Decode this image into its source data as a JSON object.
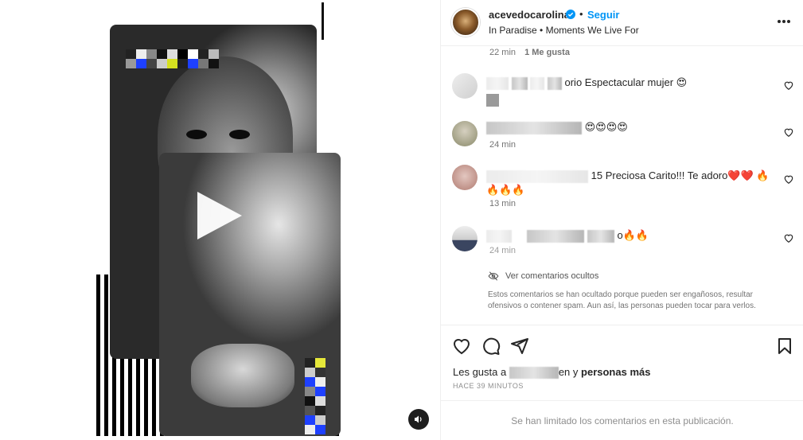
{
  "post": {
    "username": "acevedocarolina",
    "follow_label": "Seguir",
    "dot": "•",
    "location": "In Paradise • Moments We Live For"
  },
  "top_meta": {
    "time": "22 min",
    "likes": "1 Me gusta"
  },
  "comments": [
    {
      "text_visible": "orio Espectacular mujer 😍",
      "time": ""
    },
    {
      "text_visible": "😍😍😍😍",
      "time": "24 min"
    },
    {
      "text_visible": "15 Preciosa Carito!!! Te adoro❤️❤️ 🔥",
      "line2": "🔥🔥🔥",
      "time": "13 min"
    },
    {
      "text_visible": "o🔥🔥",
      "time": "24 min"
    }
  ],
  "hidden_comments": {
    "toggle_label": "Ver comentarios ocultos",
    "note": "Estos comentarios se han ocultado porque pueden ser engañosos, resultar ofensivos o contener spam. Aun así, las personas pueden tocar para verlos."
  },
  "likes_line": {
    "prefix": "Les gusta a ",
    "middle": "en",
    "suffix": " y ",
    "bold": "personas más"
  },
  "post_time": "HACE 39 MINUTOS",
  "limited_comments": "Se han limitado los comentarios en esta publicación.",
  "colors": {
    "accent": "#0095f6",
    "verified": "#0095f6",
    "text": "#262626",
    "muted": "#737373"
  },
  "icons": [
    "verified-icon",
    "more-icon",
    "heart-icon",
    "comment-icon",
    "share-icon",
    "bookmark-icon",
    "play-icon",
    "volume-icon",
    "eye-off-icon"
  ]
}
